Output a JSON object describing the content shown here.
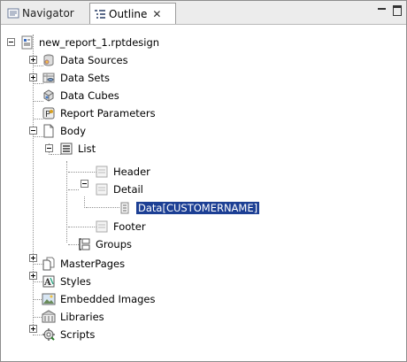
{
  "tabs": [
    {
      "label": "Navigator",
      "icon": "navigator-icon",
      "active": false
    },
    {
      "label": "Outline",
      "icon": "outline-icon",
      "active": true
    }
  ],
  "tree": {
    "root": {
      "label": "new_report_1.rptdesign",
      "icon": "report-design-icon",
      "expanded": true
    },
    "data_sources": {
      "label": "Data Sources",
      "icon": "data-source-icon"
    },
    "data_sets": {
      "label": "Data Sets",
      "icon": "data-set-icon"
    },
    "data_cubes": {
      "label": "Data Cubes",
      "icon": "data-cube-icon"
    },
    "report_parameters": {
      "label": "Report Parameters",
      "icon": "parameter-icon"
    },
    "body": {
      "label": "Body",
      "icon": "page-icon"
    },
    "list": {
      "label": "List",
      "icon": "list-icon"
    },
    "header": {
      "label": "Header",
      "icon": "band-icon"
    },
    "detail": {
      "label": "Detail",
      "icon": "band-icon"
    },
    "data_item": {
      "label": "Data[CUSTOMERNAME]",
      "icon": "data-item-icon",
      "selected": true
    },
    "footer": {
      "label": "Footer",
      "icon": "band-icon"
    },
    "groups": {
      "label": "Groups",
      "icon": "groups-icon"
    },
    "master_pages": {
      "label": "MasterPages",
      "icon": "master-page-icon"
    },
    "styles": {
      "label": "Styles",
      "icon": "styles-icon"
    },
    "embedded_images": {
      "label": "Embedded Images",
      "icon": "image-icon"
    },
    "libraries": {
      "label": "Libraries",
      "icon": "library-icon"
    },
    "scripts": {
      "label": "Scripts",
      "icon": "script-icon"
    }
  },
  "colors": {
    "selection": "#1c3f94",
    "tab_bar": "#ececec"
  }
}
